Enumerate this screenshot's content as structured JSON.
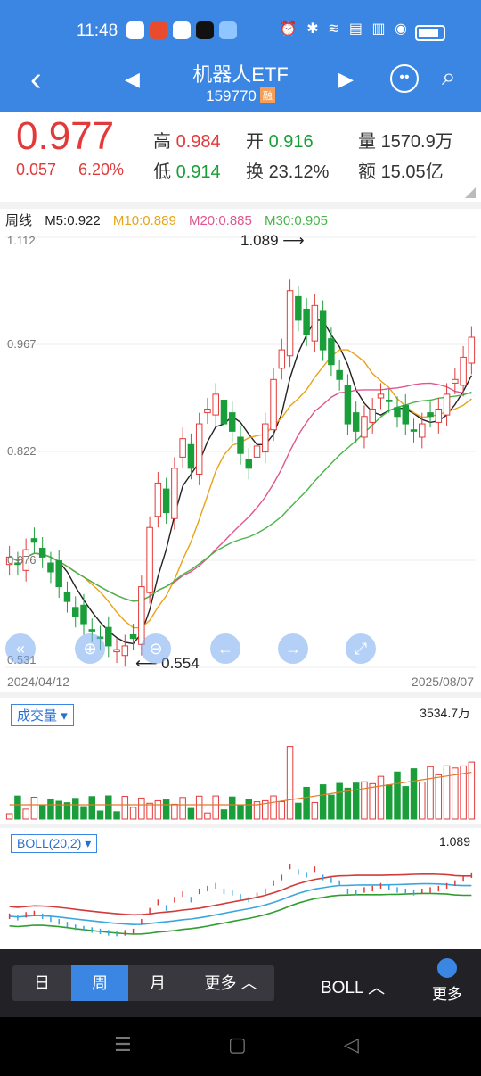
{
  "status_bar": {
    "time": "11:48"
  },
  "header": {
    "title": "机器人ETF",
    "code": "159770",
    "badge": "融"
  },
  "quote": {
    "price": "0.977",
    "change": "0.057",
    "change_pct": "6.20%",
    "high_label": "高",
    "high": "0.984",
    "open_label": "开",
    "open": "0.916",
    "vol_label": "量",
    "vol": "1570.9万",
    "low_label": "低",
    "low": "0.914",
    "turnover_label": "换",
    "turnover": "23.12%",
    "amount_label": "额",
    "amount": "15.05亿"
  },
  "ma_legend": {
    "period": "周线",
    "m5": "M5:0.922",
    "m10": "M10:0.889",
    "m20": "M20:0.885",
    "m30": "M30:0.905"
  },
  "chart_data": {
    "type": "candlestick",
    "y_ticks": [
      "1.112",
      "0.967",
      "0.822",
      "0.676",
      "0.531"
    ],
    "x_start": "2024/04/12",
    "x_end": "2025/08/07",
    "high_marker": "1.089",
    "low_marker": "0.554"
  },
  "volume": {
    "label": "成交量",
    "value": "3534.7万"
  },
  "boll": {
    "label": "BOLL(20,2)",
    "value": "1.089"
  },
  "bottom_bar": {
    "tab_day": "日",
    "tab_week": "周",
    "tab_month": "月",
    "tab_more": "更多",
    "indicator": "BOLL",
    "more": "更多"
  },
  "colors": {
    "accent": "#3c86e3",
    "up": "#e23a3a",
    "down": "#1a9e3a"
  }
}
